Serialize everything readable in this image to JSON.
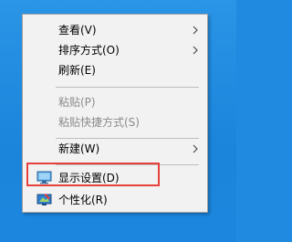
{
  "context_menu": {
    "items": [
      {
        "label": "查看(V)",
        "enabled": true,
        "submenu": true
      },
      {
        "label": "排序方式(O)",
        "enabled": true,
        "submenu": true
      },
      {
        "label": "刷新(E)",
        "enabled": true,
        "submenu": false
      },
      {
        "label": "粘贴(P)",
        "enabled": false,
        "submenu": false
      },
      {
        "label": "粘贴快捷方式(S)",
        "enabled": false,
        "submenu": false
      },
      {
        "label": "新建(W)",
        "enabled": true,
        "submenu": true
      },
      {
        "label": "显示设置(D)",
        "enabled": true,
        "submenu": false,
        "icon": "display-icon",
        "highlighted": true
      },
      {
        "label": "个性化(R)",
        "enabled": true,
        "submenu": false,
        "icon": "personalize-icon"
      }
    ]
  },
  "colors": {
    "desktop": "#1f8ae0",
    "menu_background": "#f2f2f2",
    "disabled_text": "#8b8b8b",
    "highlight_box": "#e8403a"
  }
}
